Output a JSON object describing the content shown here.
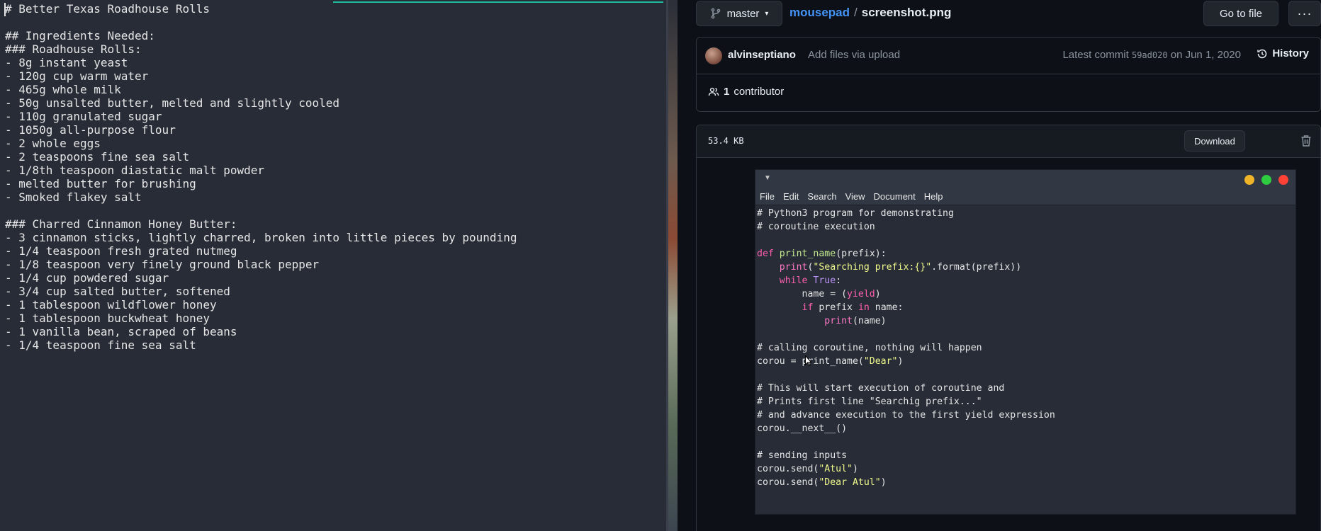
{
  "editor": {
    "lines": [
      "# Better Texas Roadhouse Rolls",
      "",
      "## Ingredients Needed:",
      "### Roadhouse Rolls:",
      "- 8g instant yeast",
      "- 120g cup warm water",
      "- 465g whole milk",
      "- 50g unsalted butter, melted and slightly cooled",
      "- 110g granulated sugar",
      "- 1050g all-purpose flour",
      "- 2 whole eggs",
      "- 2 teaspoons fine sea salt",
      "- 1/8th teaspoon diastatic malt powder",
      "- melted butter for brushing",
      "- Smoked flakey salt",
      "",
      "### Charred Cinnamon Honey Butter:",
      "- 3 cinnamon sticks, lightly charred, broken into little pieces by pounding",
      "- 1/4 teaspoon fresh grated nutmeg",
      "- 1/8 teaspoon very finely ground black pepper",
      "- 1/4 cup powdered sugar",
      "- 3/4 cup salted butter, softened",
      "- 1 tablespoon wildflower honey",
      "- 1 tablespoon buckwheat honey",
      "- 1 vanilla bean, scraped of beans",
      "- 1/4 teaspoon fine sea salt"
    ]
  },
  "github": {
    "branch": "master",
    "repo": "mousepad",
    "separator": "/",
    "file": "screenshot.png",
    "goto_label": "Go to file",
    "more_label": "···",
    "commit": {
      "author": "alvinseptiano",
      "message": "Add files via upload",
      "latest_prefix": "Latest commit",
      "sha": "59ad020",
      "date": "on Jun 1, 2020",
      "history_label": "History"
    },
    "contributors_count": "1",
    "contributors_label": "contributor",
    "file_size": "53.4 KB",
    "download_label": "Download"
  },
  "embedded": {
    "menu": [
      "File",
      "Edit",
      "Search",
      "View",
      "Document",
      "Help"
    ],
    "window_buttons": {
      "minimize": "#f0b429",
      "maximize": "#2ecc40",
      "close": "#ff4136"
    }
  },
  "colors": {
    "link": "#4493f8",
    "accent_bar": "#1abc9c",
    "editor_bg": "#272c37"
  }
}
